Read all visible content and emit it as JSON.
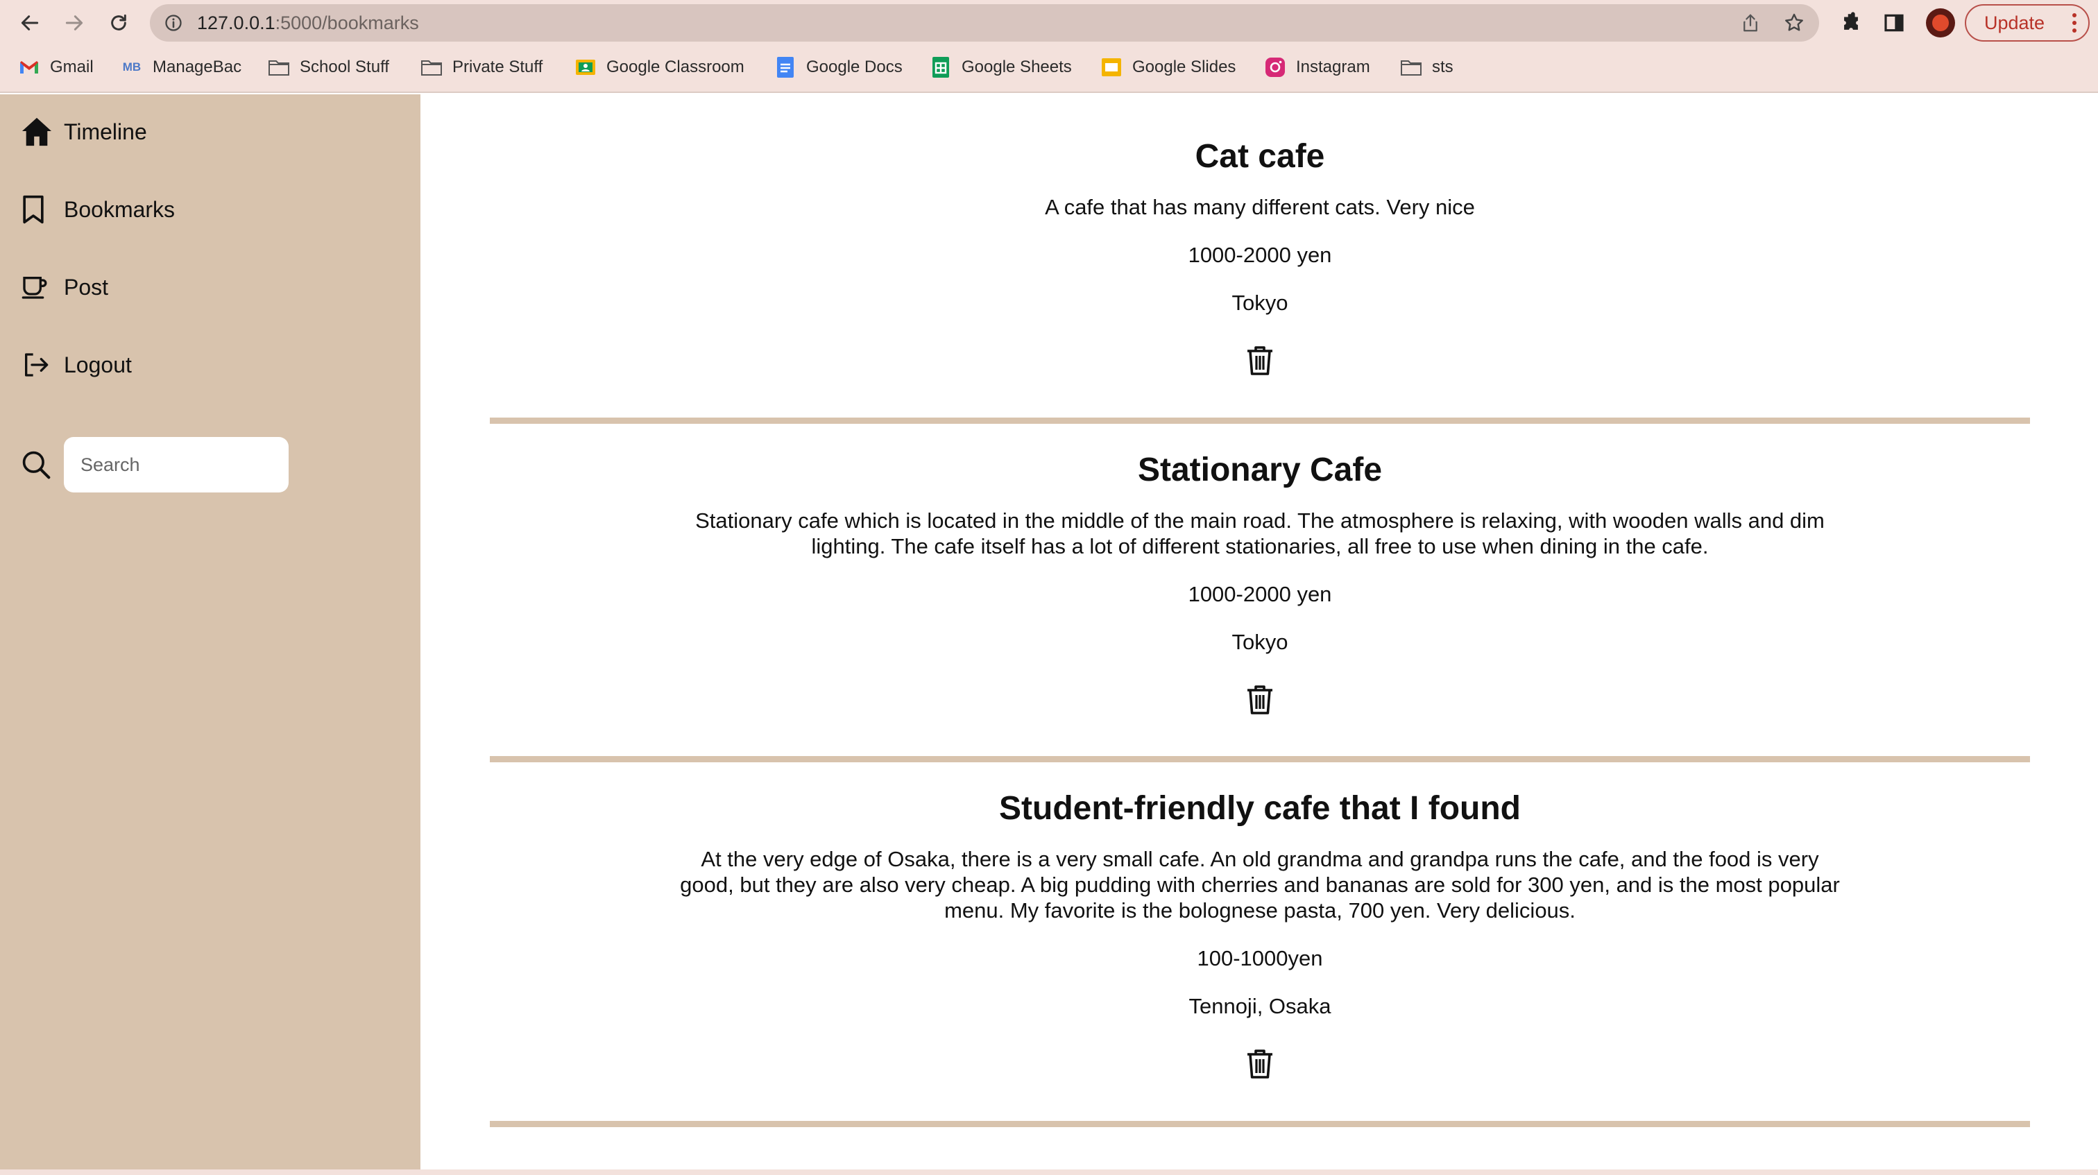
{
  "browser": {
    "url_host": "127.0.0.1",
    "url_path": ":5000/bookmarks",
    "update_label": "Update"
  },
  "bookmarks_bar": [
    {
      "label": "Gmail",
      "icon": "gmail-icon"
    },
    {
      "label": "ManageBac",
      "icon": "managebac-icon"
    },
    {
      "label": "School Stuff",
      "icon": "folder-icon"
    },
    {
      "label": "Private Stuff",
      "icon": "folder-icon"
    },
    {
      "label": "Google Classroom",
      "icon": "google-classroom-icon"
    },
    {
      "label": "Google Docs",
      "icon": "google-docs-icon"
    },
    {
      "label": "Google Sheets",
      "icon": "google-sheets-icon"
    },
    {
      "label": "Google Slides",
      "icon": "google-slides-icon"
    },
    {
      "label": "Instagram",
      "icon": "instagram-icon"
    },
    {
      "label": "sts",
      "icon": "folder-icon"
    }
  ],
  "sidebar": {
    "items": [
      {
        "label": "Timeline",
        "icon": "home-icon"
      },
      {
        "label": "Bookmarks",
        "icon": "bookmark-icon"
      },
      {
        "label": "Post",
        "icon": "cup-icon"
      },
      {
        "label": "Logout",
        "icon": "logout-icon"
      }
    ],
    "search_placeholder": "Search"
  },
  "posts": [
    {
      "title": "Cat cafe",
      "description": "A cafe that has many different cats. Very nice",
      "price": "1000-2000 yen",
      "location": "Tokyo"
    },
    {
      "title": "Stationary Cafe",
      "description": "Stationary cafe which is located in the middle of the main road. The atmosphere is relaxing, with wooden walls and dim lighting. The cafe itself has a lot of different stationaries, all free to use when dining in the cafe.",
      "price": "1000-2000 yen",
      "location": "Tokyo"
    },
    {
      "title": "Student-friendly cafe that I found",
      "description": "At the very edge of Osaka, there is a very small cafe. An old grandma and grandpa runs the cafe, and the food is very good, but they are also very cheap. A big pudding with cherries and bananas are sold for 300 yen, and is the most popular menu. My favorite is the bolognese pasta, 700 yen. Very delicious.",
      "price": "100-1000yen",
      "location": "Tennoji, Osaka"
    }
  ],
  "colors": {
    "sidebar_bg": "#d8c3ad",
    "chrome_bg": "#f3e1dc",
    "divider": "#d8c3ad",
    "update_accent": "#b83228"
  }
}
